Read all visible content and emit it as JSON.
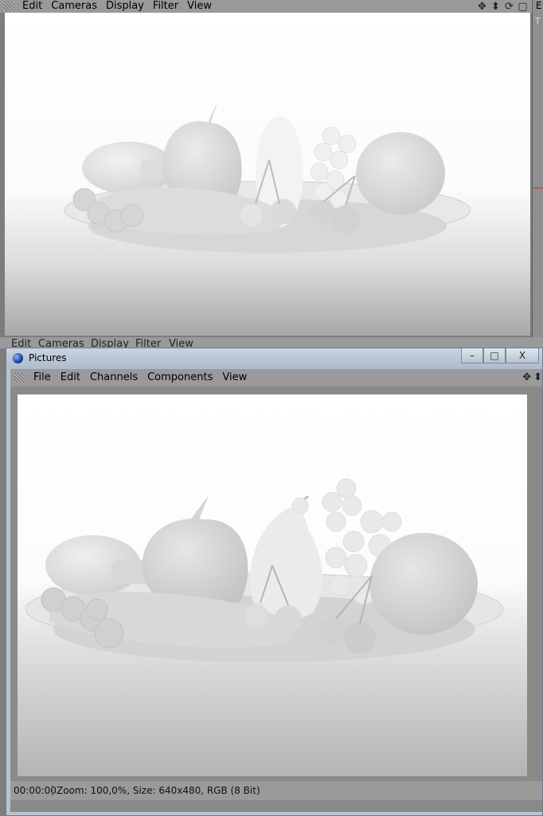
{
  "top_viewport": {
    "menu": [
      "Edit",
      "Cameras",
      "Display",
      "Filter",
      "View"
    ],
    "tool_icons": [
      "move-icon",
      "scale-icon",
      "rotate-icon",
      "maximize-icon"
    ],
    "right_strip_label": "E",
    "right_strip_sub": "T"
  },
  "lower_viewport": {
    "menu": [
      "Edit",
      "Cameras",
      "Display",
      "Filter",
      "View"
    ]
  },
  "pictures_window": {
    "title": "Pictures",
    "window_buttons": {
      "minimize": "–",
      "maximize": "□",
      "close": "X"
    },
    "menu": [
      "File",
      "Edit",
      "Channels",
      "Components",
      "View"
    ],
    "status": {
      "time": "00:00:00",
      "info": "Zoom: 100,0%, Size: 640x480, RGB (8 Bit)"
    }
  },
  "icons": {
    "move": "✥",
    "scale": "⬍",
    "rotate": "⟳",
    "maximize": "▢"
  }
}
